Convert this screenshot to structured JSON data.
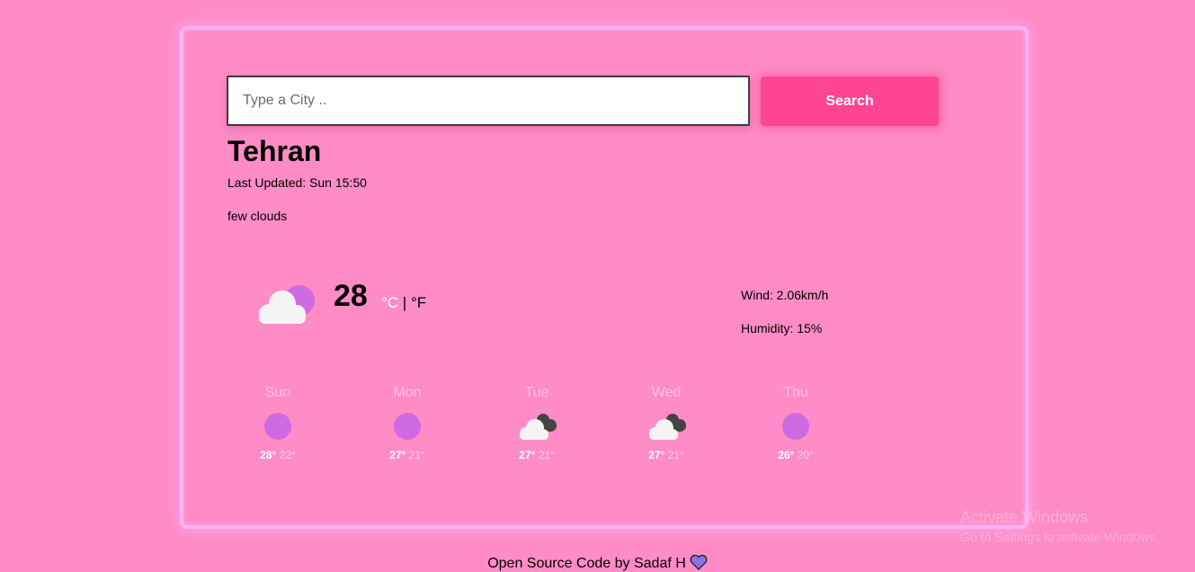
{
  "search": {
    "placeholder": "Type a City ..",
    "value": "",
    "button_label": "Search"
  },
  "current": {
    "city": "Tehran",
    "last_updated": "Last Updated: Sun 15:50",
    "description": "few clouds",
    "temperature": "28",
    "unit_c": "°C",
    "unit_separator": " | ",
    "unit_f": "°F",
    "icon": "few-clouds-icon",
    "wind": "Wind: 2.06km/h",
    "humidity": "Humidity: 15%"
  },
  "forecast": [
    {
      "day": "Sun",
      "max": "28°",
      "min": "22°",
      "icon": "clear-sky-icon"
    },
    {
      "day": "Mon",
      "max": "27°",
      "min": "21°",
      "icon": "clear-sky-icon"
    },
    {
      "day": "Tue",
      "max": "27°",
      "min": "21°",
      "icon": "broken-clouds-icon"
    },
    {
      "day": "Wed",
      "max": "27°",
      "min": "21°",
      "icon": "broken-clouds-icon"
    },
    {
      "day": "Thu",
      "max": "26°",
      "min": "20°",
      "icon": "clear-sky-icon"
    }
  ],
  "footer": {
    "text": "Open Source Code by Sadaf H"
  },
  "watermark": {
    "title": "Activate Windows",
    "subtitle": "Go to Settings to activate Windows."
  },
  "colors": {
    "background": "#ff8cc6",
    "card_border": "#ffb3f0",
    "button": "#ff4592",
    "sun": "#cf6be2",
    "heart": "#8a73e6"
  }
}
